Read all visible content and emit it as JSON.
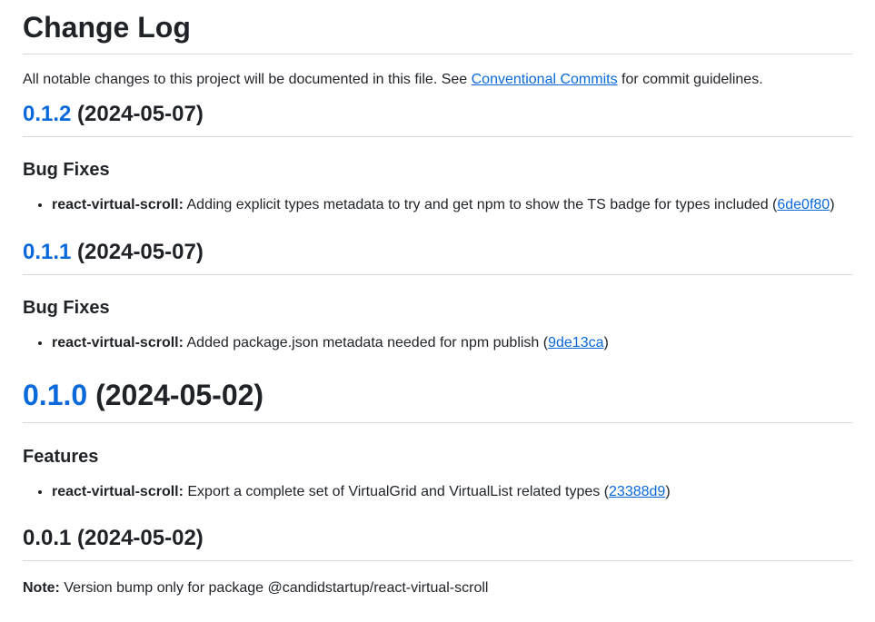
{
  "title": "Change Log",
  "intro": {
    "text_before": "All notable changes to this project will be documented in this file. See ",
    "link_text": "Conventional Commits",
    "text_after": " for commit guidelines."
  },
  "releases": [
    {
      "version": "0.1.2",
      "date": " (2024-05-07)",
      "section": "Bug Fixes",
      "item": {
        "scope": "react-virtual-scroll:",
        "text": " Adding explicit types metadata to try and get npm to show the TS badge for types included (",
        "commit": "6de0f80",
        "close": ")"
      }
    },
    {
      "version": "0.1.1",
      "date": " (2024-05-07)",
      "section": "Bug Fixes",
      "item": {
        "scope": "react-virtual-scroll:",
        "text": " Added package.json metadata needed for npm publish (",
        "commit": "9de13ca",
        "close": ")"
      }
    },
    {
      "version": "0.1.0",
      "date": " (2024-05-02)",
      "section": "Features",
      "item": {
        "scope": "react-virtual-scroll:",
        "text": " Export a complete set of VirtualGrid and VirtualList related types (",
        "commit": "23388d9",
        "close": ")"
      }
    },
    {
      "heading": "0.0.1 (2024-05-02)",
      "note_label": "Note:",
      "note_text": " Version bump only for package @candidstartup/react-virtual-scroll"
    }
  ]
}
